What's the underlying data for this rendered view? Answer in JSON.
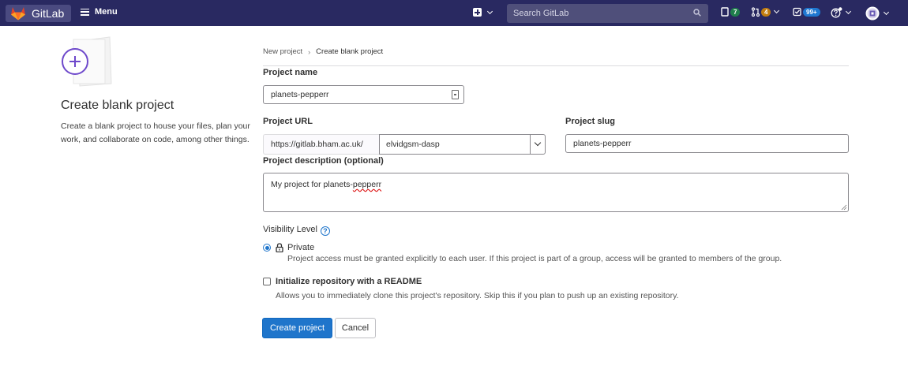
{
  "navbar": {
    "brand": "GitLab",
    "menu_label": "Menu",
    "search_placeholder": "Search GitLab",
    "issues_count": "7",
    "merge_requests_count": "4",
    "todos_count": "99+"
  },
  "sidebar": {
    "title": "Create blank project",
    "description": "Create a blank project to house your files, plan your work, and collaborate on code, among other things."
  },
  "breadcrumb": {
    "parent": "New project",
    "separator": "›",
    "current": "Create blank project"
  },
  "form": {
    "project_name_label": "Project name",
    "project_name_value": "planets-pepperr",
    "project_url_label": "Project URL",
    "url_prefix": "https://gitlab.bham.ac.uk/",
    "namespace_value": "elvidgsm-dasp",
    "project_slug_label": "Project slug",
    "project_slug_value": "planets-pepperr",
    "description_label": "Project description (optional)",
    "description_prefix": "My project for planets-",
    "description_suffix": "pepperr",
    "visibility_label": "Visibility Level",
    "visibility_option_title": "Private",
    "visibility_option_desc": "Project access must be granted explicitly to each user. If this project is part of a group, access will be granted to members of the group.",
    "readme_label": "Initialize repository with a README",
    "readme_desc": "Allows you to immediately clone this project's repository. Skip this if you plan to push up an existing repository.",
    "create_button": "Create project",
    "cancel_button": "Cancel"
  },
  "colors": {
    "navbar_bg": "#292961",
    "primary": "#1f75cb",
    "accent_illustration": "#6e49cb"
  }
}
